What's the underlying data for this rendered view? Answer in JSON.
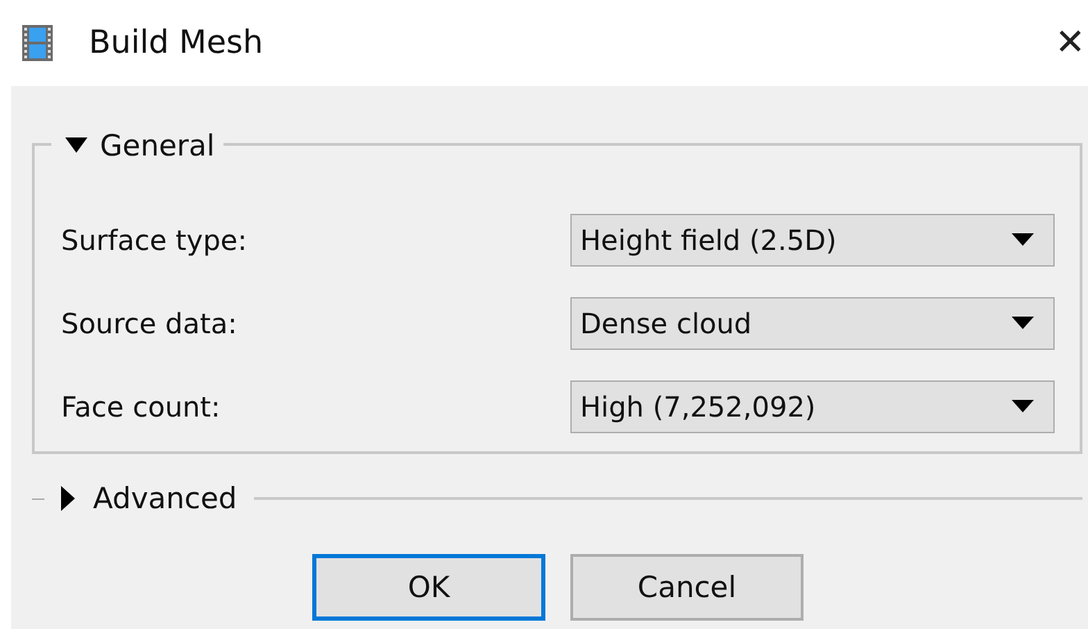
{
  "window": {
    "title": "Build Mesh",
    "close": "✕"
  },
  "sections": [
    {
      "label": "General",
      "expanded": true,
      "fields": [
        {
          "label": "Surface type:",
          "value": "Height field (2.5D)"
        },
        {
          "label": "Source data:",
          "value": "Dense cloud"
        },
        {
          "label": "Face count:",
          "value": "High (7,252,092)"
        }
      ]
    },
    {
      "label": "Advanced",
      "expanded": false
    }
  ],
  "buttons": [
    {
      "label": "OK",
      "default": true
    },
    {
      "label": "Cancel",
      "default": false
    }
  ]
}
